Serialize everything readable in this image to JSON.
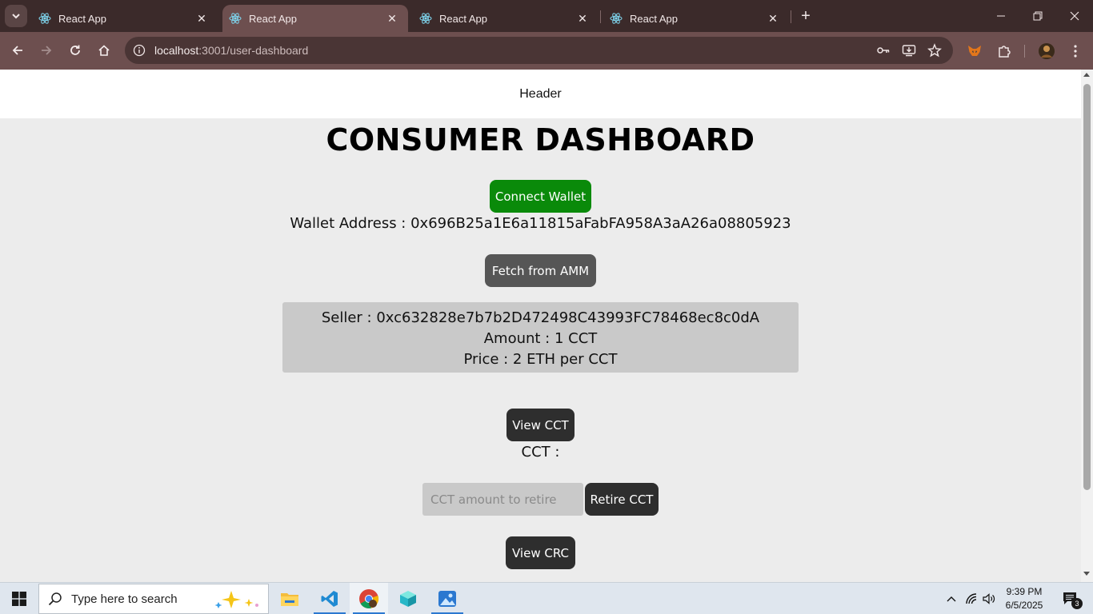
{
  "browser": {
    "tabs": [
      {
        "title": "React App",
        "active": false
      },
      {
        "title": "React App",
        "active": true
      },
      {
        "title": "React App",
        "active": false
      },
      {
        "title": "React App",
        "active": false
      }
    ],
    "url_host": "localhost",
    "url_path": ":3001/user-dashboard"
  },
  "page": {
    "header_text": "Header",
    "title": "CONSUMER DASHBOARD",
    "connect_wallet_label": "Connect Wallet",
    "wallet_address_line": "Wallet Address : 0x696B25a1E6a11815aFabFA958A3aA26a08805923",
    "fetch_amm_label": "Fetch from AMM",
    "listing": {
      "seller": "Seller : 0xc632828e7b7b2D472498C43993FC78468ec8c0dA",
      "amount": "Amount : 1 CCT",
      "price": "Price : 2 ETH per CCT"
    },
    "view_cct_label": "View CCT",
    "cct_line": "CCT :",
    "retire_placeholder": "CCT amount to retire",
    "retire_label": "Retire CCT",
    "view_crc_label": "View CRC"
  },
  "taskbar": {
    "search_placeholder": "Type here to search",
    "time": "9:39 PM",
    "date": "6/5/2025",
    "notification_count": "3"
  },
  "colors": {
    "connect_button": "#0a8a0a",
    "fetch_button": "#565656",
    "dark_button": "#2e2e2e",
    "listing_bg": "#c9c9c9",
    "page_bg": "#ececec",
    "browser_frame": "#6d4f4f"
  }
}
